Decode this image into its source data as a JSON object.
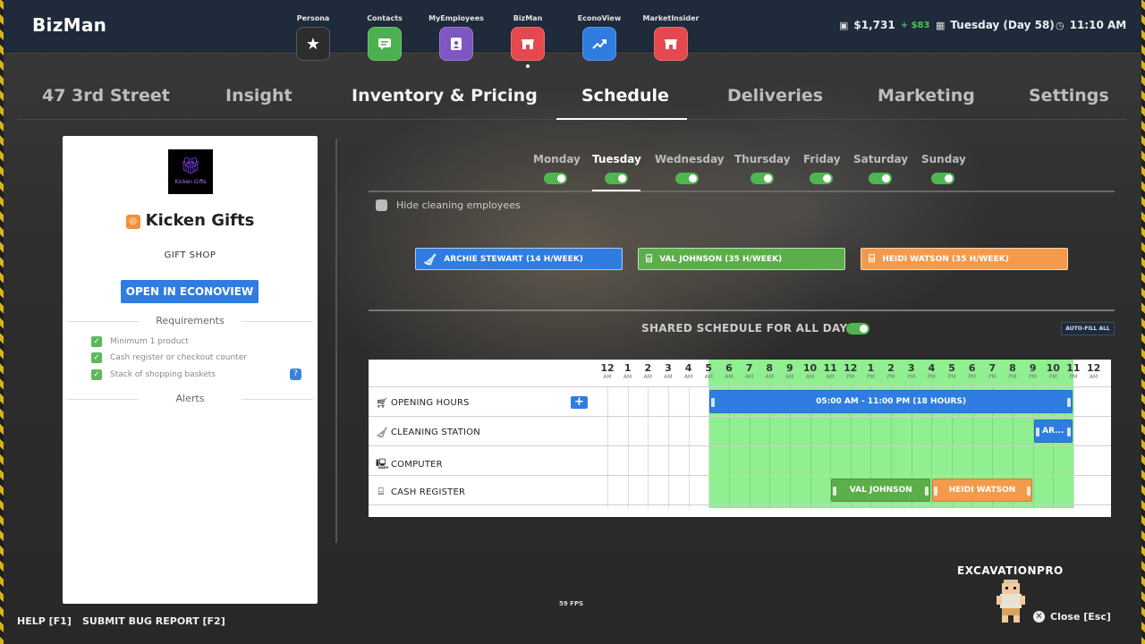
{
  "topbar": {
    "brand": "BizMan",
    "apps": [
      {
        "label": "Persona",
        "icon": "star-icon",
        "color": "#2d2d2d"
      },
      {
        "label": "Contacts",
        "icon": "chat-icon",
        "color": "#4caf50"
      },
      {
        "label": "MyEmployees",
        "icon": "badge-icon",
        "color": "#7e57c2"
      },
      {
        "label": "BizMan",
        "icon": "store-icon",
        "color": "#e5484d"
      },
      {
        "label": "EconoView",
        "icon": "trend-icon",
        "color": "#2f7de0"
      },
      {
        "label": "MarketInsider",
        "icon": "market-icon",
        "color": "#e5484d"
      }
    ],
    "money": "$1,731",
    "money_delta": "+ $83",
    "day": "Tuesday (Day 58)",
    "time": "11:10 AM"
  },
  "tabs": [
    {
      "label": "47 3rd Street"
    },
    {
      "label": "Insight"
    },
    {
      "label": "Inventory & Pricing"
    },
    {
      "label": "Schedule"
    },
    {
      "label": "Deliveries"
    },
    {
      "label": "Marketing"
    },
    {
      "label": "Settings"
    }
  ],
  "business": {
    "logo_text": "Kicken Gifts",
    "name": "Kicken Gifts",
    "type": "GIFT SHOP",
    "econ_button": "OPEN IN ECONOVIEW",
    "requirements_title": "Requirements",
    "requirements": [
      "Minimum 1 product",
      "Cash register or checkout counter",
      "Stack of shopping baskets"
    ],
    "help_icon": "?",
    "alerts_title": "Alerts"
  },
  "schedule": {
    "days": [
      {
        "label": "Monday",
        "enabled": true
      },
      {
        "label": "Tuesday",
        "enabled": true,
        "active": true
      },
      {
        "label": "Wednesday",
        "enabled": true
      },
      {
        "label": "Thursday",
        "enabled": true
      },
      {
        "label": "Friday",
        "enabled": true
      },
      {
        "label": "Saturday",
        "enabled": true
      },
      {
        "label": "Sunday",
        "enabled": true
      }
    ],
    "hide_cleaning": "Hide cleaning employees",
    "employees": [
      {
        "label": "ARCHIE STEWART (14 H/WEEK)",
        "color": "#2f7de0",
        "icon": "broom-icon"
      },
      {
        "label": "VAL JOHNSON (35 H/WEEK)",
        "color": "#5cae4a",
        "icon": "register-icon"
      },
      {
        "label": "HEIDI WATSON (35 H/WEEK)",
        "color": "#f39a4c",
        "icon": "register-icon"
      }
    ],
    "shared_label": "SHARED SCHEDULE FOR ALL DAYS",
    "shared_enabled": true,
    "autofill": "AUTO-FILL ALL",
    "hours": [
      {
        "h": "12",
        "ap": "AM"
      },
      {
        "h": "1",
        "ap": "AM"
      },
      {
        "h": "2",
        "ap": "AM"
      },
      {
        "h": "3",
        "ap": "AM"
      },
      {
        "h": "4",
        "ap": "AM"
      },
      {
        "h": "5",
        "ap": "AM"
      },
      {
        "h": "6",
        "ap": "AM"
      },
      {
        "h": "7",
        "ap": "AM"
      },
      {
        "h": "8",
        "ap": "AM"
      },
      {
        "h": "9",
        "ap": "AM"
      },
      {
        "h": "10",
        "ap": "AM"
      },
      {
        "h": "11",
        "ap": "AM"
      },
      {
        "h": "12",
        "ap": "PM"
      },
      {
        "h": "1",
        "ap": "PM"
      },
      {
        "h": "2",
        "ap": "PM"
      },
      {
        "h": "3",
        "ap": "PM"
      },
      {
        "h": "4",
        "ap": "PM"
      },
      {
        "h": "5",
        "ap": "PM"
      },
      {
        "h": "6",
        "ap": "PM"
      },
      {
        "h": "7",
        "ap": "PM"
      },
      {
        "h": "8",
        "ap": "PM"
      },
      {
        "h": "9",
        "ap": "PM"
      },
      {
        "h": "10",
        "ap": "PM"
      },
      {
        "h": "11",
        "ap": "PM"
      },
      {
        "h": "12",
        "ap": "AM"
      }
    ],
    "open_hour": 5,
    "close_hour": 23,
    "rows": [
      {
        "label": "OPENING HOURS",
        "icon": "cart-icon"
      },
      {
        "label": "CLEANING STATION",
        "icon": "broom-icon"
      },
      {
        "label": "COMPUTER",
        "icon": "computer-icon"
      },
      {
        "label": "CASH REGISTER",
        "icon": "register-icon"
      }
    ],
    "opening_block": {
      "label": "05:00 AM - 11:00 PM (18 HOURS)",
      "start": 5,
      "end": 23,
      "color": "#2f7de0"
    },
    "shift_blocks": [
      {
        "label": "AR...",
        "row": 1,
        "start": 21,
        "end": 23,
        "color": "#2f7de0"
      },
      {
        "label": "VAL JOHNSON",
        "row": 3,
        "start": 11,
        "end": 16,
        "color": "#5cae4a"
      },
      {
        "label": "HEIDI WATSON",
        "row": 3,
        "start": 16,
        "end": 21,
        "color": "#f39a4c"
      }
    ]
  },
  "footer": {
    "fps": "59 FPS",
    "help": "HELP [F1]",
    "bug": "SUBMIT BUG REPORT [F2]",
    "creator": "EXCAVATIONPRO",
    "close": "Close [Esc]"
  }
}
